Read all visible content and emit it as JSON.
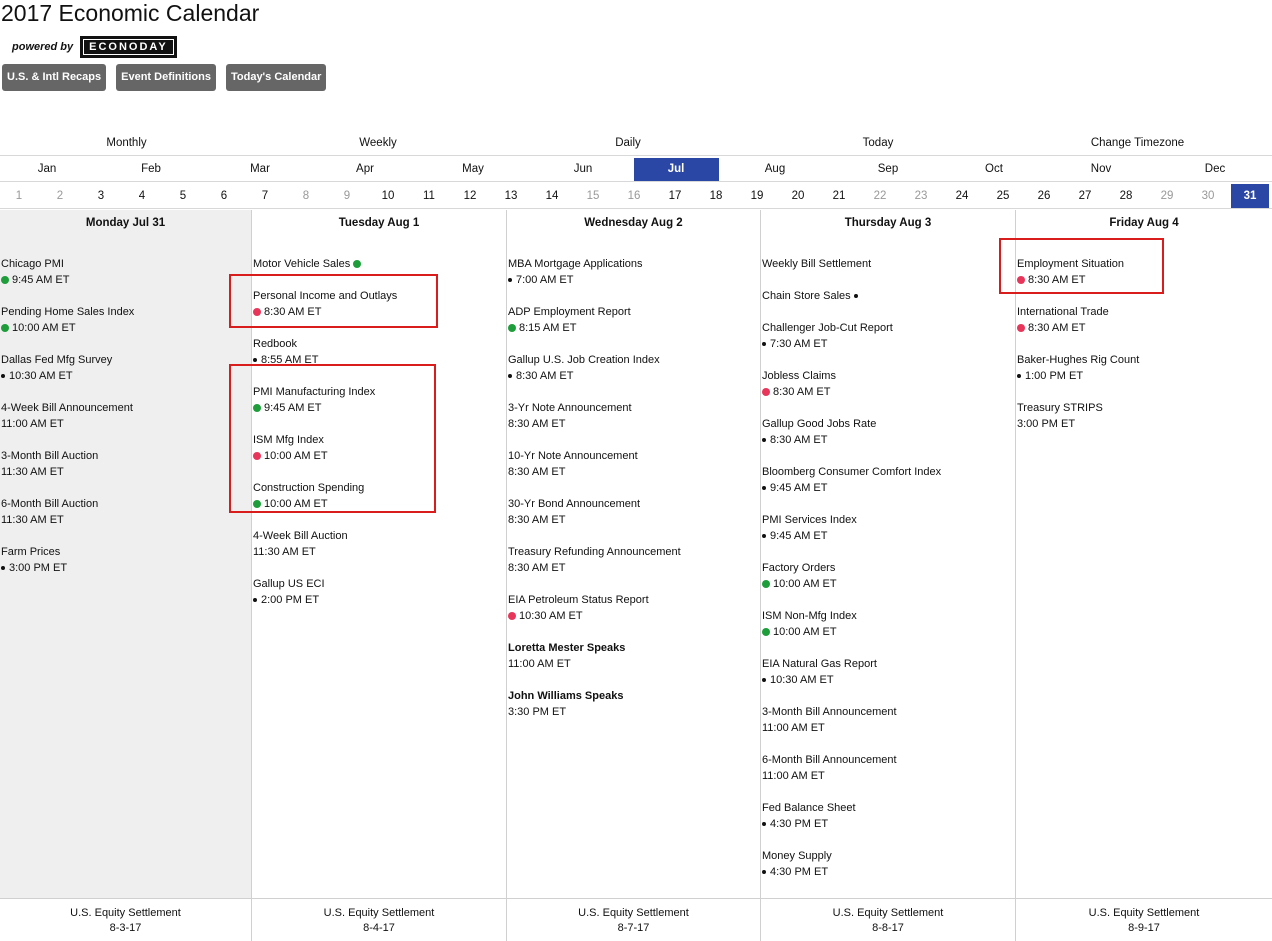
{
  "page_title": "2017 Economic Calendar",
  "powered_by": "powered by",
  "logo_text": "ECONODAY",
  "buttons": [
    "U.S. & Intl Recaps",
    "Event Definitions",
    "Today's Calendar"
  ],
  "view_tabs": [
    {
      "label": "Monthly",
      "active": false
    },
    {
      "label": "Weekly",
      "active": true
    },
    {
      "label": "Daily",
      "active": false
    },
    {
      "label": "Today",
      "active": false
    },
    {
      "label": "Change Timezone",
      "active": false
    }
  ],
  "months": [
    {
      "label": "Jan",
      "active": false
    },
    {
      "label": "Feb",
      "active": false
    },
    {
      "label": "Mar",
      "active": false
    },
    {
      "label": "Apr",
      "active": false
    },
    {
      "label": "May",
      "active": false
    },
    {
      "label": "Jun",
      "active": false
    },
    {
      "label": "Jul",
      "active": true
    },
    {
      "label": "Aug",
      "active": false
    },
    {
      "label": "Sep",
      "active": false
    },
    {
      "label": "Oct",
      "active": false
    },
    {
      "label": "Nov",
      "active": false
    },
    {
      "label": "Dec",
      "active": false
    }
  ],
  "days": [
    {
      "label": "1",
      "state": "gray"
    },
    {
      "label": "2",
      "state": "gray"
    },
    {
      "label": "3",
      "state": "normal"
    },
    {
      "label": "4",
      "state": "normal"
    },
    {
      "label": "5",
      "state": "normal"
    },
    {
      "label": "6",
      "state": "normal"
    },
    {
      "label": "7",
      "state": "normal"
    },
    {
      "label": "8",
      "state": "gray"
    },
    {
      "label": "9",
      "state": "gray"
    },
    {
      "label": "10",
      "state": "normal"
    },
    {
      "label": "11",
      "state": "normal"
    },
    {
      "label": "12",
      "state": "normal"
    },
    {
      "label": "13",
      "state": "normal"
    },
    {
      "label": "14",
      "state": "normal"
    },
    {
      "label": "15",
      "state": "gray"
    },
    {
      "label": "16",
      "state": "gray"
    },
    {
      "label": "17",
      "state": "normal"
    },
    {
      "label": "18",
      "state": "normal"
    },
    {
      "label": "19",
      "state": "normal"
    },
    {
      "label": "20",
      "state": "normal"
    },
    {
      "label": "21",
      "state": "normal"
    },
    {
      "label": "22",
      "state": "gray"
    },
    {
      "label": "23",
      "state": "gray"
    },
    {
      "label": "24",
      "state": "normal"
    },
    {
      "label": "25",
      "state": "normal"
    },
    {
      "label": "26",
      "state": "normal"
    },
    {
      "label": "27",
      "state": "normal"
    },
    {
      "label": "28",
      "state": "normal"
    },
    {
      "label": "29",
      "state": "gray"
    },
    {
      "label": "30",
      "state": "gray"
    },
    {
      "label": "31",
      "state": "active"
    }
  ],
  "columns": [
    {
      "header": "Monday Jul 31",
      "shaded": true,
      "events": [
        {
          "name": "Chicago PMI",
          "time": "9:45 AM ET",
          "marker": "green"
        },
        {
          "name": "Pending Home Sales Index",
          "time": "10:00 AM ET",
          "marker": "green"
        },
        {
          "name": "Dallas Fed Mfg Survey",
          "time": "10:30 AM ET",
          "marker": "black"
        },
        {
          "name": "4-Week Bill Announcement",
          "time": "11:00 AM ET",
          "marker": "none"
        },
        {
          "name": "3-Month Bill Auction",
          "time": "11:30 AM ET",
          "marker": "none"
        },
        {
          "name": "6-Month Bill Auction",
          "time": "11:30 AM ET",
          "marker": "none"
        },
        {
          "name": "Farm Prices",
          "time": "3:00 PM ET",
          "marker": "black"
        }
      ],
      "footer_title": "U.S. Equity Settlement",
      "footer_date": "8-3-17"
    },
    {
      "header": "Tuesday Aug 1",
      "shaded": false,
      "events": [
        {
          "name": "Motor Vehicle Sales",
          "time": "",
          "marker": "green-after"
        },
        {
          "name": "Personal Income and Outlays",
          "time": "8:30 AM ET",
          "marker": "red"
        },
        {
          "name": "Redbook",
          "time": "8:55 AM ET",
          "marker": "black"
        },
        {
          "name": "PMI Manufacturing Index",
          "time": "9:45 AM ET",
          "marker": "green"
        },
        {
          "name": "ISM Mfg Index",
          "time": "10:00 AM ET",
          "marker": "red"
        },
        {
          "name": "Construction Spending",
          "time": "10:00 AM ET",
          "marker": "green"
        },
        {
          "name": "4-Week Bill Auction",
          "time": "11:30 AM ET",
          "marker": "none"
        },
        {
          "name": "Gallup US ECI",
          "time": "2:00 PM ET",
          "marker": "black"
        }
      ],
      "footer_title": "U.S. Equity Settlement",
      "footer_date": "8-4-17"
    },
    {
      "header": "Wednesday Aug 2",
      "shaded": false,
      "events": [
        {
          "name": "MBA Mortgage Applications",
          "time": "7:00 AM ET",
          "marker": "black"
        },
        {
          "name": "ADP Employment Report",
          "time": "8:15 AM ET",
          "marker": "green"
        },
        {
          "name": "Gallup U.S. Job Creation Index",
          "time": "8:30 AM ET",
          "marker": "black"
        },
        {
          "name": "3-Yr Note Announcement",
          "time": "8:30 AM ET",
          "marker": "none"
        },
        {
          "name": "10-Yr Note Announcement",
          "time": "8:30 AM ET",
          "marker": "none"
        },
        {
          "name": "30-Yr Bond Announcement",
          "time": "8:30 AM ET",
          "marker": "none"
        },
        {
          "name": "Treasury Refunding Announcement",
          "time": "8:30 AM ET",
          "marker": "none"
        },
        {
          "name": "EIA Petroleum Status Report",
          "time": "10:30 AM ET",
          "marker": "red"
        },
        {
          "name": "Loretta Mester Speaks",
          "time": "11:00 AM ET",
          "marker": "none",
          "bold": true
        },
        {
          "name": "John Williams Speaks",
          "time": "3:30 PM ET",
          "marker": "none",
          "bold": true
        }
      ],
      "footer_title": "U.S. Equity Settlement",
      "footer_date": "8-7-17"
    },
    {
      "header": "Thursday Aug 3",
      "shaded": false,
      "events": [
        {
          "name": "Weekly Bill Settlement",
          "time": "",
          "marker": "none"
        },
        {
          "name": "Chain Store Sales",
          "time": "",
          "marker": "black-after"
        },
        {
          "name": "Challenger Job-Cut Report",
          "time": "7:30 AM ET",
          "marker": "black"
        },
        {
          "name": "Jobless Claims",
          "time": "8:30 AM ET",
          "marker": "red"
        },
        {
          "name": "Gallup Good Jobs Rate",
          "time": "8:30 AM ET",
          "marker": "black"
        },
        {
          "name": "Bloomberg Consumer Comfort Index",
          "time": "9:45 AM ET",
          "marker": "black"
        },
        {
          "name": "PMI Services Index",
          "time": "9:45 AM ET",
          "marker": "black"
        },
        {
          "name": "Factory Orders",
          "time": "10:00 AM ET",
          "marker": "green"
        },
        {
          "name": "ISM Non-Mfg Index",
          "time": "10:00 AM ET",
          "marker": "green"
        },
        {
          "name": "EIA Natural Gas Report",
          "time": "10:30 AM ET",
          "marker": "black"
        },
        {
          "name": "3-Month Bill Announcement",
          "time": "11:00 AM ET",
          "marker": "none"
        },
        {
          "name": "6-Month Bill Announcement",
          "time": "11:00 AM ET",
          "marker": "none"
        },
        {
          "name": "Fed Balance Sheet",
          "time": "4:30 PM ET",
          "marker": "black"
        },
        {
          "name": "Money Supply",
          "time": "4:30 PM ET",
          "marker": "black"
        }
      ],
      "footer_title": "U.S. Equity Settlement",
      "footer_date": "8-8-17"
    },
    {
      "header": "Friday Aug 4",
      "shaded": false,
      "events": [
        {
          "name": "Employment Situation",
          "time": "8:30 AM ET",
          "marker": "red"
        },
        {
          "name": "International Trade",
          "time": "8:30 AM ET",
          "marker": "red"
        },
        {
          "name": "Baker-Hughes Rig Count",
          "time": "1:00 PM ET",
          "marker": "black"
        },
        {
          "name": "Treasury STRIPS",
          "time": "3:00 PM ET",
          "marker": "none"
        }
      ],
      "footer_title": "U.S. Equity Settlement",
      "footer_date": "8-9-17"
    }
  ]
}
